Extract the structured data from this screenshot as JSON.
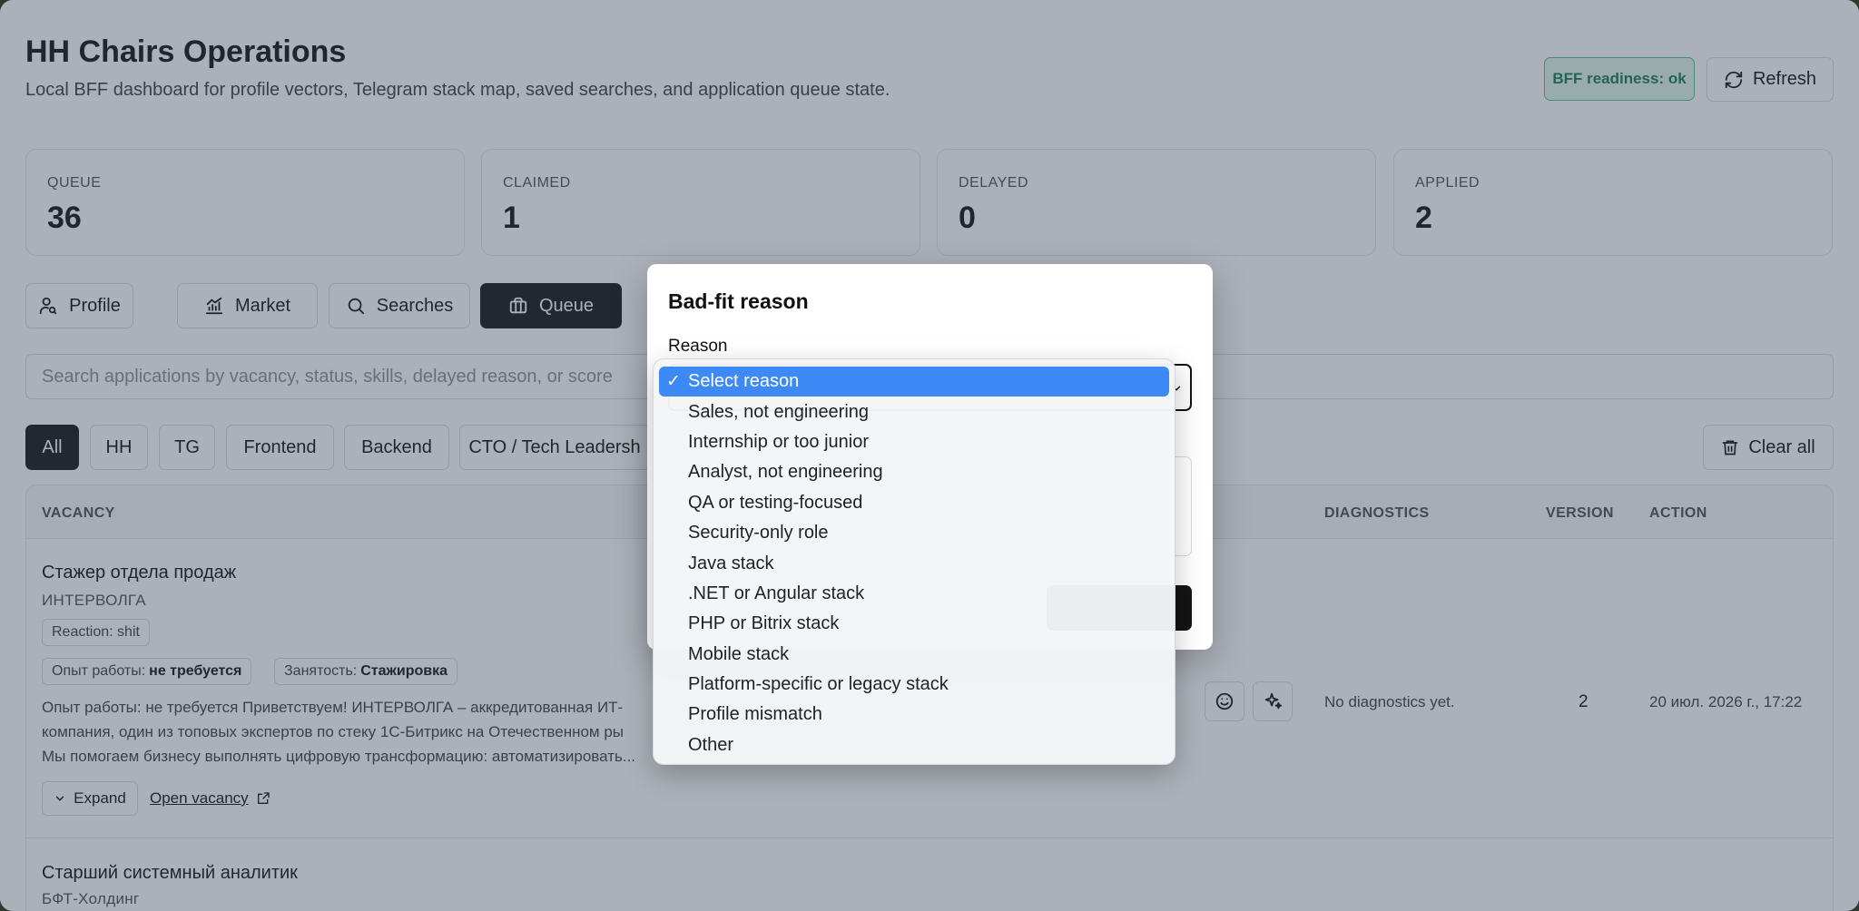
{
  "header": {
    "title": "HH Chairs Operations",
    "subtitle": "Local BFF dashboard for profile vectors, Telegram stack map, saved searches, and application queue state.",
    "readiness": "BFF readiness: ok",
    "refresh_label": "Refresh"
  },
  "stats": [
    {
      "label": "QUEUE",
      "value": "36"
    },
    {
      "label": "CLAIMED",
      "value": "1"
    },
    {
      "label": "DELAYED",
      "value": "0"
    },
    {
      "label": "APPLIED",
      "value": "2"
    }
  ],
  "tabs": [
    {
      "label": "Profile",
      "icon": "user-search-icon"
    },
    {
      "label": "Market",
      "icon": "chart-icon"
    },
    {
      "label": "Searches",
      "icon": "search-icon"
    },
    {
      "label": "Queue",
      "icon": "briefcase-icon",
      "active": true
    }
  ],
  "search": {
    "placeholder": "Search applications by vacancy, status, skills, delayed reason, or score"
  },
  "filters": [
    "All",
    "HH",
    "TG",
    "Frontend",
    "Backend",
    "CTO / Tech Leadersh"
  ],
  "clear_all_label": "Clear all",
  "table": {
    "headers": {
      "vacancy": "VACANCY",
      "diagnostics": "DIAGNOSTICS",
      "version": "VERSION",
      "action": "ACTION"
    },
    "rows": [
      {
        "title": "Стажер отдела продаж",
        "company": "ИНТЕРВОЛГА",
        "reaction": "Reaction: shit",
        "experience_label": "Опыт работы:",
        "experience_value": "не требуется",
        "employment_label": "Занятость:",
        "employment_value": "Стажировка",
        "description_lines": [
          "Опыт работы: не требуется Приветствуем! ИНТЕРВОЛГА – аккредитованная ИТ-",
          "компания, один из топовых экспертов по стеку 1С-Битрикс на Отечественном ры",
          "Мы помогаем бизнесу выполнять цифровую трансформацию: автоматизировать..."
        ],
        "expand_label": "Expand",
        "open_label": "Open vacancy",
        "diagnostics": "No diagnostics yet.",
        "version": "2",
        "action_date": "20 июл. 2026 г., 17:22"
      },
      {
        "title": "Старший системный аналитик",
        "company": "БФТ-Холдинг"
      }
    ]
  },
  "modal": {
    "title": "Bad-fit reason",
    "reason_label": "Reason",
    "options": [
      "Select reason",
      "Sales, not engineering",
      "Internship or too junior",
      "Analyst, not engineering",
      "QA or testing-focused",
      "Security-only role",
      "Java stack",
      ".NET or Angular stack",
      "PHP or Bitrix stack",
      "Mobile stack",
      "Platform-specific or legacy stack",
      "Profile mismatch",
      "Other"
    ],
    "selected_index": 0
  },
  "colors": {
    "accent": "#141414",
    "ok_bg": "#dff6ea",
    "ok_text": "#177a4e",
    "select_highlight": "#3d8af7"
  }
}
